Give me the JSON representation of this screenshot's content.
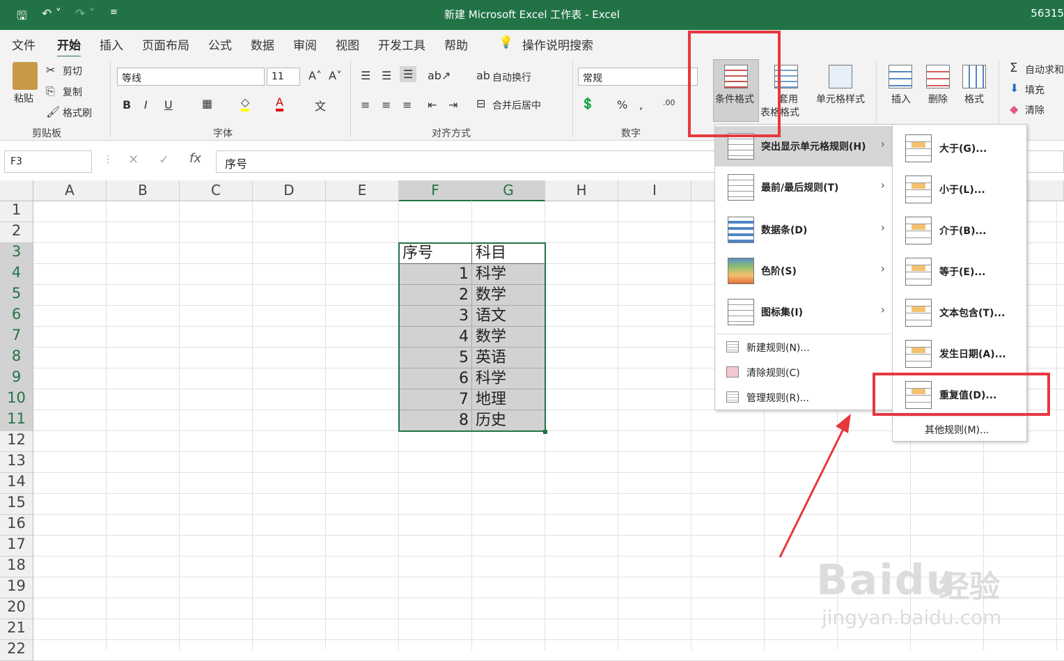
{
  "window": {
    "title": "新建 Microsoft Excel 工作表  -  Excel",
    "number_fragment": "56315"
  },
  "tabs": [
    "文件",
    "开始",
    "插入",
    "页面布局",
    "公式",
    "数据",
    "审阅",
    "视图",
    "开发工具",
    "帮助"
  ],
  "tell_me": "操作说明搜索",
  "clipboard": {
    "paste": "粘贴",
    "cut": "剪切",
    "copy": "复制",
    "format_painter": "格式刷",
    "group": "剪贴板"
  },
  "font": {
    "name": "等线",
    "size": "11",
    "group": "字体",
    "bold": "B",
    "italic": "I",
    "underline": "U"
  },
  "alignment": {
    "wrap": "自动换行",
    "merge": "合并后居中",
    "group": "对齐方式"
  },
  "number": {
    "format": "常规",
    "percent": "%",
    "comma": ",",
    "group": "数字"
  },
  "styles": {
    "conditional": "条件格式",
    "table_format_1": "套用",
    "table_format_2": "表格格式",
    "cell_styles": "单元格样式"
  },
  "cells": {
    "insert": "插入",
    "delete": "删除",
    "format": "格式"
  },
  "editing": {
    "autosum": "自动求和",
    "fill": "填充",
    "clear": "清除"
  },
  "namebox": "F3",
  "formula": "序号",
  "columns": [
    "A",
    "B",
    "C",
    "D",
    "E",
    "F",
    "G",
    "H",
    "I"
  ],
  "rows": [
    "1",
    "2",
    "3",
    "4",
    "5",
    "6",
    "7",
    "8",
    "9",
    "10",
    "11",
    "12",
    "13",
    "14",
    "15",
    "16",
    "17",
    "18",
    "19",
    "20",
    "21",
    "22"
  ],
  "table": {
    "header": [
      "序号",
      "科目"
    ],
    "rows": [
      [
        "1",
        "科学"
      ],
      [
        "2",
        "数学"
      ],
      [
        "3",
        "语文"
      ],
      [
        "4",
        "数学"
      ],
      [
        "5",
        "英语"
      ],
      [
        "6",
        "科学"
      ],
      [
        "7",
        "地理"
      ],
      [
        "8",
        "历史"
      ]
    ]
  },
  "cf_menu": {
    "items": [
      "突出显示单元格规则(H)",
      "最前/最后规则(T)",
      "数据条(D)",
      "色阶(S)",
      "图标集(I)"
    ],
    "actions": [
      "新建规则(N)...",
      "清除规则(C)",
      "管理规则(R)..."
    ]
  },
  "highlight_submenu": {
    "items": [
      "大于(G)...",
      "小于(L)...",
      "介于(B)...",
      "等于(E)...",
      "文本包含(T)...",
      "发生日期(A)...",
      "重复值(D)..."
    ],
    "more": "其他规则(M)..."
  },
  "watermark": {
    "brand": "Baidu",
    "cn": "经验",
    "url": "jingyan.baidu.com"
  },
  "colors": {
    "excel_green": "#217346",
    "annotation_red": "#e8373f"
  }
}
